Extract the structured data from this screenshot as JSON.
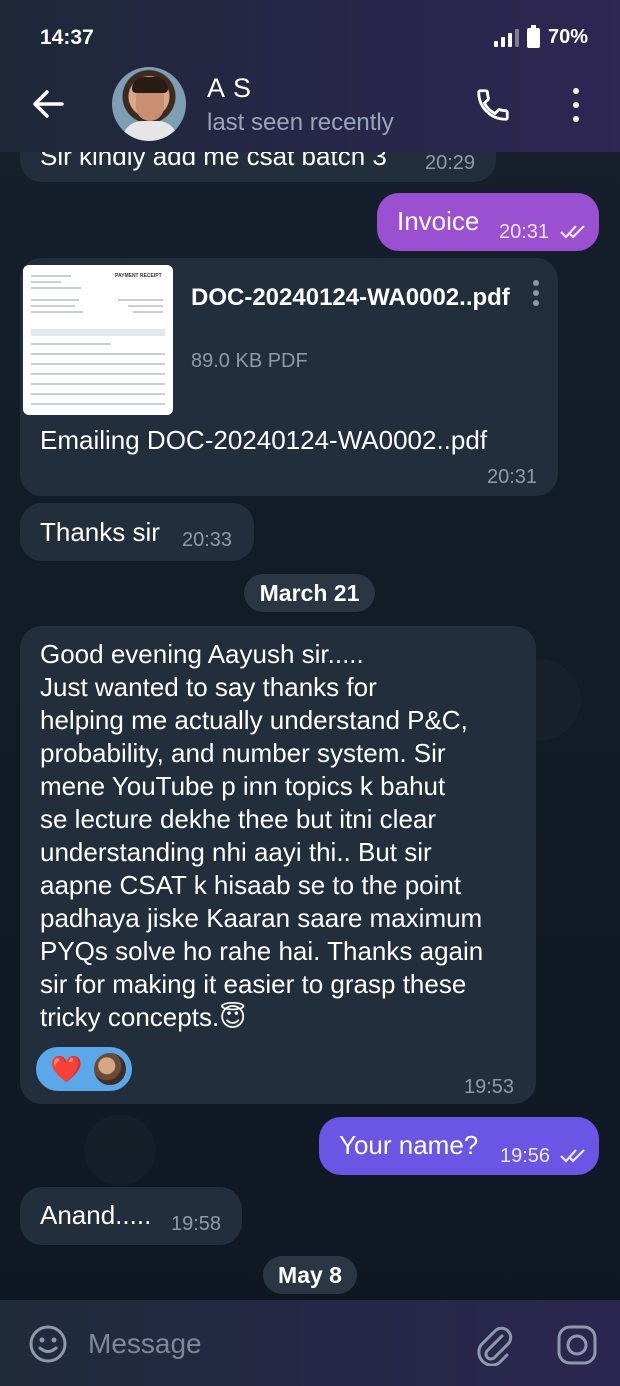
{
  "status_bar": {
    "time": "14:37",
    "battery": "70%"
  },
  "header": {
    "contact_name": "A S",
    "contact_status": "last seen recently"
  },
  "messages": [
    {
      "id": "m0",
      "direction": "in",
      "text": "Sir kindly add me csat batch 3",
      "time": "20:29"
    },
    {
      "id": "m1",
      "direction": "out",
      "text": "Invoice",
      "time": "20:31",
      "read": true
    },
    {
      "id": "m2",
      "direction": "in",
      "doc_name": "DOC-20240124-WA0002..pdf",
      "doc_meta": "89.0 KB PDF",
      "doc_thumb_title": "PAYMENT RECEIPT",
      "text": "Emailing DOC-20240124-WA0002..pdf",
      "time": "20:31"
    },
    {
      "id": "m3",
      "direction": "in",
      "text": "Thanks sir",
      "time": "20:33"
    },
    {
      "id": "m4",
      "direction": "in",
      "text": "Good evening Aayush sir.....\nJust wanted to say thanks for\nhelping me actually understand P&C,\nprobability, and number system. Sir\nmene YouTube p inn topics k bahut\nse lecture dekhe thee but itni clear\nunderstanding nhi aayi thi.. But sir\naapne CSAT k hisaab se to the point\npadhaya jiske Kaaran saare maximum\nPYQs solve ho rahe hai. Thanks again\nsir for making it easier to grasp these\ntricky concepts.😇",
      "time": "19:53",
      "reactions": [
        "❤️"
      ]
    },
    {
      "id": "m5",
      "direction": "out",
      "text": "Your name?",
      "time": "19:56",
      "read": true
    },
    {
      "id": "m6",
      "direction": "in",
      "text": "Anand.....",
      "time": "19:58"
    }
  ],
  "date_separators": [
    "March 21",
    "May 8"
  ],
  "input": {
    "placeholder": "Message"
  },
  "colors": {
    "accent_out_1": "#9b4fd1",
    "accent_out_2": "#6a55e4",
    "bubble_in": "#232e3c",
    "reaction_bg": "#5aa7ea"
  },
  "icons": [
    "back-arrow-icon",
    "phone-icon",
    "more-vertical-icon",
    "double-check-icon",
    "emoji-icon",
    "attach-icon",
    "camera-icon",
    "heart-icon"
  ]
}
